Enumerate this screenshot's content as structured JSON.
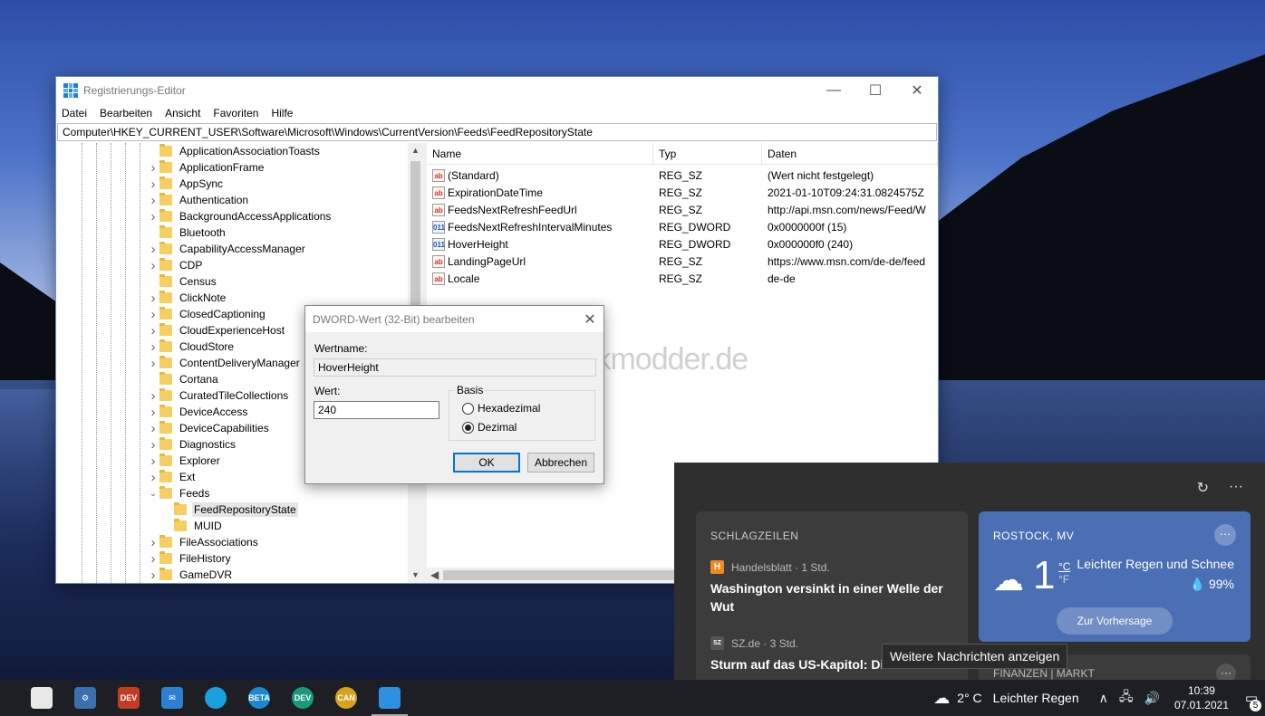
{
  "window": {
    "title": "Registrierungs-Editor",
    "controls": {
      "minimize": "—",
      "maximize": "☐",
      "close": "✕"
    },
    "menu": [
      "Datei",
      "Bearbeiten",
      "Ansicht",
      "Favoriten",
      "Hilfe"
    ],
    "address": "Computer\\HKEY_CURRENT_USER\\Software\\Microsoft\\Windows\\CurrentVersion\\Feeds\\FeedRepositoryState"
  },
  "tree": [
    {
      "label": "ApplicationAssociationToasts",
      "depth": 0,
      "expander": "",
      "selected": false
    },
    {
      "label": "ApplicationFrame",
      "depth": 0,
      "expander": ">",
      "selected": false
    },
    {
      "label": "AppSync",
      "depth": 0,
      "expander": ">",
      "selected": false
    },
    {
      "label": "Authentication",
      "depth": 0,
      "expander": ">",
      "selected": false
    },
    {
      "label": "BackgroundAccessApplications",
      "depth": 0,
      "expander": ">",
      "selected": false
    },
    {
      "label": "Bluetooth",
      "depth": 0,
      "expander": "",
      "selected": false
    },
    {
      "label": "CapabilityAccessManager",
      "depth": 0,
      "expander": ">",
      "selected": false
    },
    {
      "label": "CDP",
      "depth": 0,
      "expander": ">",
      "selected": false
    },
    {
      "label": "Census",
      "depth": 0,
      "expander": "",
      "selected": false
    },
    {
      "label": "ClickNote",
      "depth": 0,
      "expander": ">",
      "selected": false
    },
    {
      "label": "ClosedCaptioning",
      "depth": 0,
      "expander": ">",
      "selected": false
    },
    {
      "label": "CloudExperienceHost",
      "depth": 0,
      "expander": ">",
      "selected": false
    },
    {
      "label": "CloudStore",
      "depth": 0,
      "expander": ">",
      "selected": false
    },
    {
      "label": "ContentDeliveryManager",
      "depth": 0,
      "expander": ">",
      "selected": false
    },
    {
      "label": "Cortana",
      "depth": 0,
      "expander": "",
      "selected": false
    },
    {
      "label": "CuratedTileCollections",
      "depth": 0,
      "expander": ">",
      "selected": false
    },
    {
      "label": "DeviceAccess",
      "depth": 0,
      "expander": ">",
      "selected": false
    },
    {
      "label": "DeviceCapabilities",
      "depth": 0,
      "expander": ">",
      "selected": false
    },
    {
      "label": "Diagnostics",
      "depth": 0,
      "expander": ">",
      "selected": false
    },
    {
      "label": "Explorer",
      "depth": 0,
      "expander": ">",
      "selected": false
    },
    {
      "label": "Ext",
      "depth": 0,
      "expander": ">",
      "selected": false
    },
    {
      "label": "Feeds",
      "depth": 0,
      "expander": "v",
      "selected": false
    },
    {
      "label": "FeedRepositoryState",
      "depth": 1,
      "expander": "",
      "selected": true
    },
    {
      "label": "MUID",
      "depth": 1,
      "expander": "",
      "selected": false
    },
    {
      "label": "FileAssociations",
      "depth": 0,
      "expander": ">",
      "selected": false
    },
    {
      "label": "FileHistory",
      "depth": 0,
      "expander": ">",
      "selected": false
    },
    {
      "label": "GameDVR",
      "depth": 0,
      "expander": ">",
      "selected": false
    }
  ],
  "list": {
    "headers": {
      "name": "Name",
      "type": "Typ",
      "data": "Daten"
    },
    "rows": [
      {
        "icon": "ab",
        "name": "(Standard)",
        "type": "REG_SZ",
        "data": "(Wert nicht festgelegt)"
      },
      {
        "icon": "ab",
        "name": "ExpirationDateTime",
        "type": "REG_SZ",
        "data": "2021-01-10T09:24:31.0824575Z"
      },
      {
        "icon": "ab",
        "name": "FeedsNextRefreshFeedUrl",
        "type": "REG_SZ",
        "data": "http://api.msn.com/news/Feed/W"
      },
      {
        "icon": "011",
        "name": "FeedsNextRefreshIntervalMinutes",
        "type": "REG_DWORD",
        "data": "0x0000000f (15)"
      },
      {
        "icon": "011",
        "name": "HoverHeight",
        "type": "REG_DWORD",
        "data": "0x000000f0 (240)"
      },
      {
        "icon": "ab",
        "name": "LandingPageUrl",
        "type": "REG_SZ",
        "data": "https://www.msn.com/de-de/feed"
      },
      {
        "icon": "ab",
        "name": "Locale",
        "type": "REG_SZ",
        "data": "de-de"
      }
    ]
  },
  "watermark": "Deskmodder.de",
  "dialog": {
    "title": "DWORD-Wert (32-Bit) bearbeiten",
    "close": "✕",
    "name_label": "Wertname:",
    "name_value": "HoverHeight",
    "value_label": "Wert:",
    "value": "240",
    "base_label": "Basis",
    "hex_label": "Hexadezimal",
    "dec_label": "Dezimal",
    "ok": "OK",
    "cancel": "Abbrechen"
  },
  "news": {
    "refresh": "↻",
    "more": "···",
    "headlines_title": "SCHLAGZEILEN",
    "story1": {
      "logo": "H",
      "source": "Handelsblatt · 1 Std.",
      "title": "Washington versinkt in einer Welle der Wut"
    },
    "story2": {
      "logo": "SZ",
      "source": "SZ.de · 3 Std.",
      "title": "Sturm auf das US-Kapitol: Die"
    },
    "weather": {
      "city": "ROSTOCK, MV",
      "more": "···",
      "temp": "1",
      "unit_c": "°C",
      "unit_f": "°F",
      "condition": "Leichter Regen und Schnee",
      "humidity": "💧 99%",
      "button": "Zur Vorhersage"
    },
    "finance_title": "FINANZEN | MARKT",
    "finance_more": "···",
    "tooltip": "Weitere Nachrichten anzeigen"
  },
  "taskbar": {
    "icons": [
      {
        "name": "store-icon",
        "label": "",
        "color": "#e8e8e8"
      },
      {
        "name": "settings-icon",
        "label": "⚙",
        "color": "#3c6fb0"
      },
      {
        "name": "dev-app-icon",
        "label": "DEV",
        "color": "#c23b22"
      },
      {
        "name": "mail-icon",
        "label": "✉",
        "color": "#2f7fd4"
      },
      {
        "name": "edge-icon",
        "label": "",
        "color": "#1aa0e0"
      },
      {
        "name": "edge-beta-icon",
        "label": "BETA",
        "color": "#1c88d0"
      },
      {
        "name": "edge-dev-icon",
        "label": "DEV",
        "color": "#1a9a7a"
      },
      {
        "name": "edge-canary-icon",
        "label": "CAN",
        "color": "#d8a21c"
      },
      {
        "name": "regedit-icon",
        "label": "",
        "color": "#2f8fe0"
      }
    ],
    "weather_temp": "2° C",
    "weather_text": "Leichter Regen",
    "time": "10:39",
    "date": "07.01.2021",
    "notifications": "5"
  }
}
